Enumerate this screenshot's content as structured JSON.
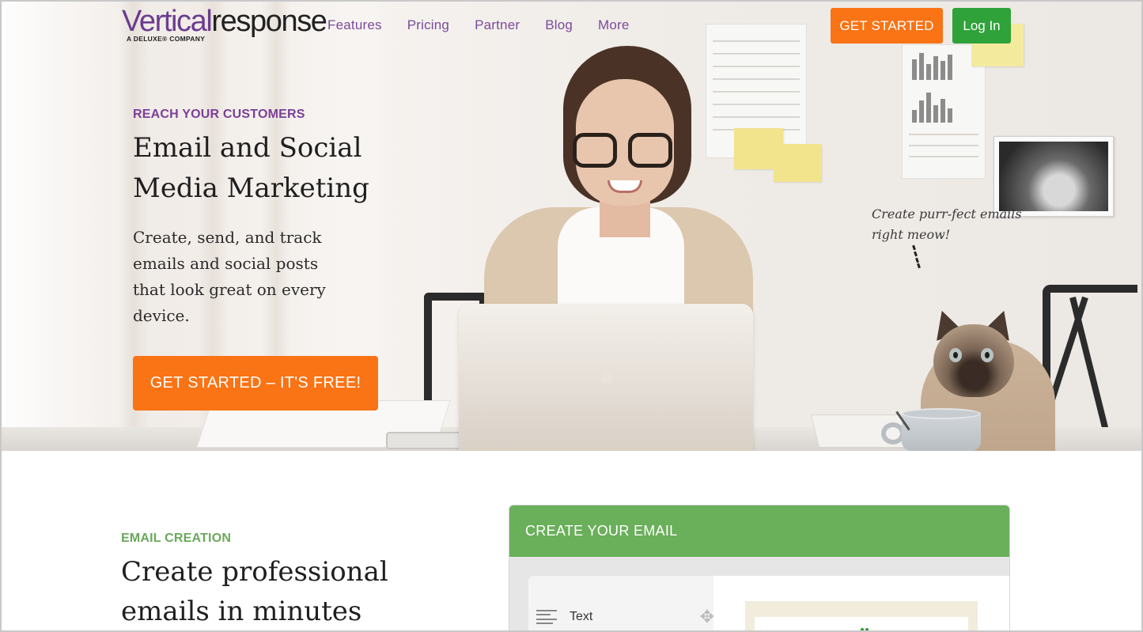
{
  "header": {
    "logo": {
      "brand_part1": "Vertical",
      "brand_part2": "response",
      "tagline": "A DELUXE® COMPANY"
    },
    "nav": [
      "Features",
      "Pricing",
      "Partner",
      "Blog",
      "More"
    ],
    "get_started": "GET STARTED",
    "log_in": "Log In"
  },
  "hero": {
    "eyebrow": "REACH YOUR CUSTOMERS",
    "title_line1": "Email and Social",
    "title_line2": "Media Marketing",
    "description": "Create, send, and track emails and social posts that look great on every device.",
    "cta": "GET STARTED – IT'S FREE!",
    "cat_quote_line1": "Create purr-fect emails",
    "cat_quote_line2": "right meow!"
  },
  "email_creation": {
    "eyebrow": "EMAIL CREATION",
    "title_line1": "Create professional",
    "title_line2": "emails in minutes",
    "panel": {
      "header": "CREATE YOUR EMAIL",
      "block_label": "Text",
      "block_icon": "text-lines-icon",
      "drag_icon": "move-arrows-icon"
    }
  },
  "colors": {
    "brand_purple": "#7b3f98",
    "orange": "#fa7314",
    "login_green": "#2fa23a",
    "panel_green": "#6aaf5a",
    "eyebrow_green": "#6aa85a"
  }
}
